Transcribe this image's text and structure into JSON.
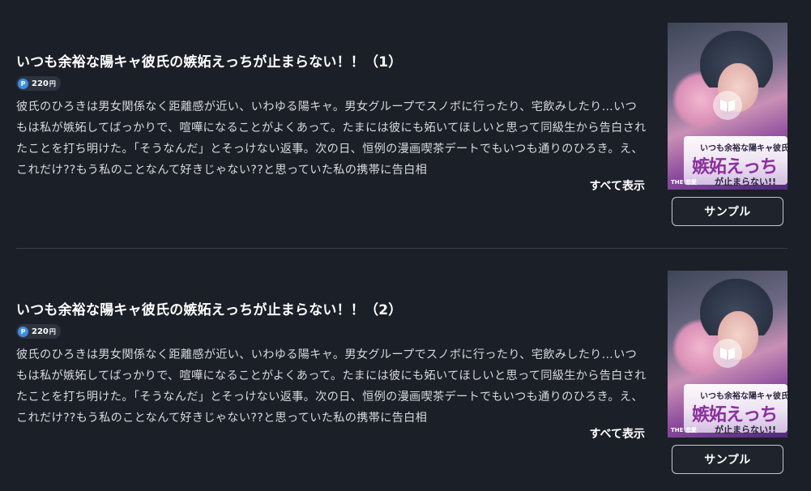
{
  "colors": {
    "background": "#1b1f27",
    "point_badge": "#3a8ee6",
    "divider": "#39404c"
  },
  "items": [
    {
      "title": "いつも余裕な陽キャ彼氏の嫉妬えっちが止まらない！！（1）",
      "point_icon": "P",
      "price": "220",
      "price_unit": "円",
      "description": "彼氏のひろきは男女関係なく距離感が近い、いわゆる陽キャ。男女グループでスノボに行ったり、宅飲みしたり…いつもは私が嫉妬してばっかりで、喧嘩になることがよくあって。たまには彼にも妬いてほしいと思って同級生から告白されたことを打ち明けた。「そうなんだ」とそっけない返事。次の日、恒例の漫画喫茶デートでもいつも通りのひろき。え、これだけ??もう私のことなんて好きじゃない??と思っていた私の携帯に告白相",
      "show_all": "すべて表示",
      "sample": "サンプル",
      "cover": {
        "title_top": "いつも余裕な陽キャ彼氏の",
        "title_mid": "嫉妬えっち",
        "title_bottom": "が止まらない!!",
        "publisher": "THE 恋愛"
      }
    },
    {
      "title": "いつも余裕な陽キャ彼氏の嫉妬えっちが止まらない！！（2）",
      "point_icon": "P",
      "price": "220",
      "price_unit": "円",
      "description": "彼氏のひろきは男女関係なく距離感が近い、いわゆる陽キャ。男女グループでスノボに行ったり、宅飲みしたり…いつもは私が嫉妬してばっかりで、喧嘩になることがよくあって。たまには彼にも妬いてほしいと思って同級生から告白されたことを打ち明けた。「そうなんだ」とそっけない返事。次の日、恒例の漫画喫茶デートでもいつも通りのひろき。え、これだけ??もう私のことなんて好きじゃない??と思っていた私の携帯に告白相",
      "show_all": "すべて表示",
      "sample": "サンプル",
      "cover": {
        "title_top": "いつも余裕な陽キャ彼氏の",
        "title_mid": "嫉妬えっち",
        "title_bottom": "が止まらない!!",
        "publisher": "THE 恋愛"
      }
    }
  ]
}
